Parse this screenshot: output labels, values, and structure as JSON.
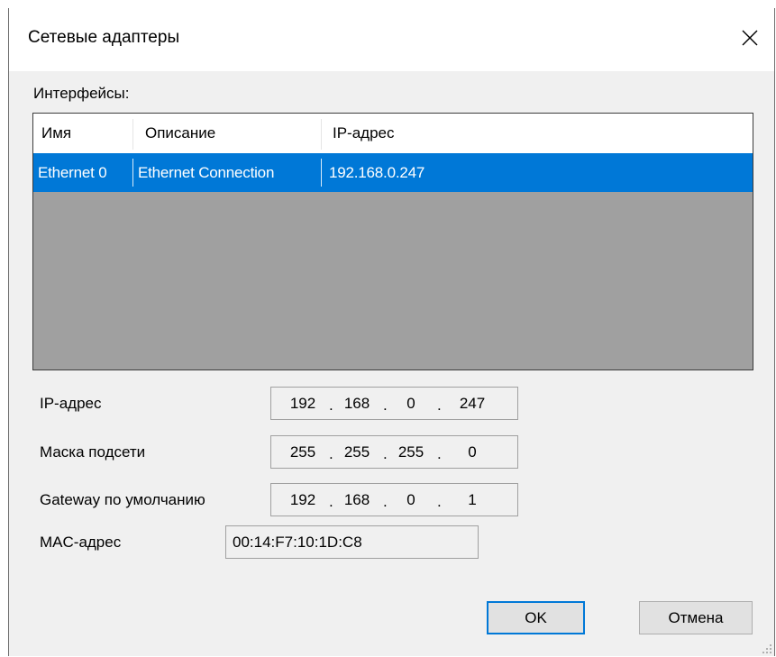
{
  "window": {
    "title": "Сетевые адаптеры",
    "close_icon": "close-icon"
  },
  "interfaces": {
    "label": "Интерфейсы:",
    "columns": [
      "Имя",
      "Описание",
      "IP-адрес"
    ],
    "rows": [
      {
        "name": "Ethernet 0",
        "description": "Ethernet Connection",
        "ip": "192.168.0.247",
        "selected": true
      }
    ]
  },
  "fields": {
    "ip": {
      "label": "IP-адрес",
      "octets": [
        "192",
        "168",
        "0",
        "247"
      ]
    },
    "mask": {
      "label": "Маска подсети",
      "octets": [
        "255",
        "255",
        "255",
        "0"
      ]
    },
    "gateway": {
      "label": "Gateway по умолчанию",
      "octets": [
        "192",
        "168",
        "0",
        "1"
      ]
    },
    "mac": {
      "label": "MAC-адрес",
      "value": "00:14:F7:10:1D:C8"
    },
    "separator": "."
  },
  "buttons": {
    "ok": "OK",
    "cancel": "Отмена"
  },
  "colors": {
    "selection": "#0078d7",
    "dialog_bg": "#f0f0f0",
    "list_bg": "#a0a0a0"
  }
}
